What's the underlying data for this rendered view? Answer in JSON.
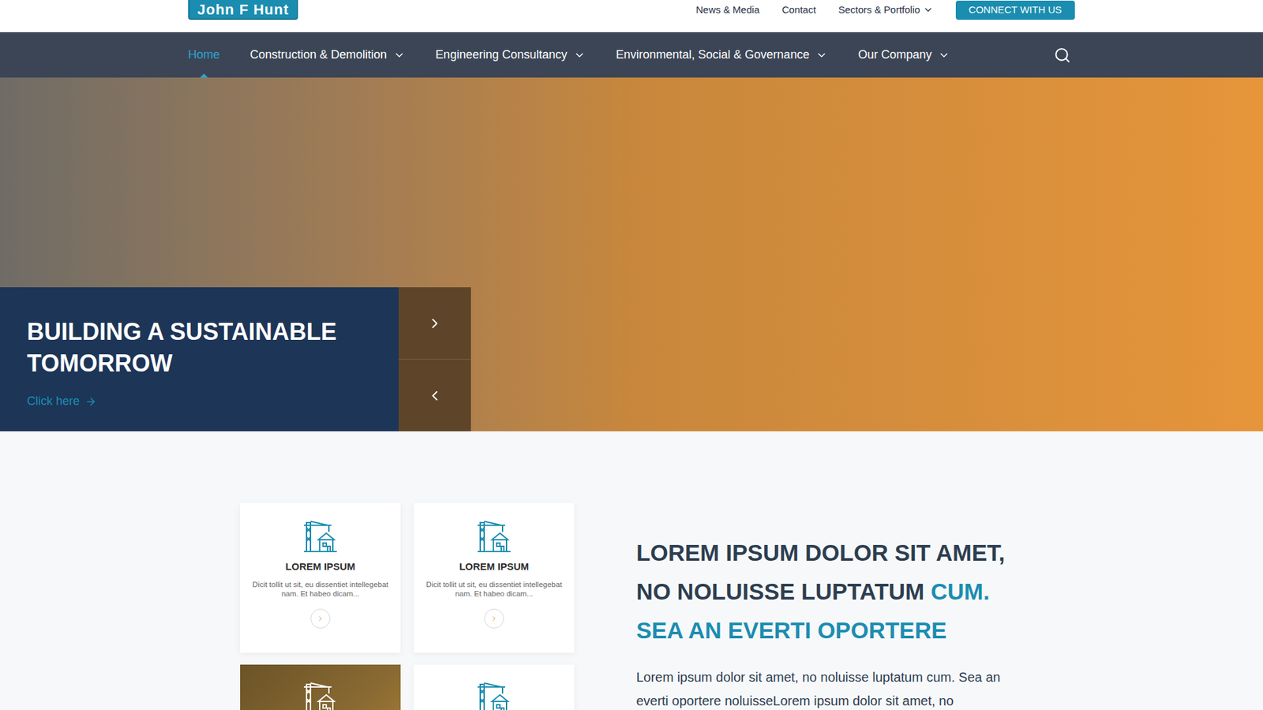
{
  "logo": "John F Hunt",
  "top_links": [
    {
      "label": "News & Media",
      "dropdown": false
    },
    {
      "label": "Contact",
      "dropdown": false
    },
    {
      "label": "Sectors & Portfolio",
      "dropdown": true
    }
  ],
  "connect_button": "CONNECT WITH US",
  "nav": [
    {
      "label": "Home",
      "selected": true,
      "dropdown": false
    },
    {
      "label": "Construction & Demolition",
      "selected": false,
      "dropdown": true
    },
    {
      "label": "Engineering Consultancy",
      "selected": false,
      "dropdown": true
    },
    {
      "label": "Environmental, Social & Governance",
      "selected": false,
      "dropdown": true
    },
    {
      "label": "Our Company",
      "selected": false,
      "dropdown": true
    }
  ],
  "hero": {
    "title": "BUILDING A SUSTAINABLE TOMORROW",
    "link": "Click here"
  },
  "cards": [
    {
      "kind": "text",
      "title": "LOREM IPSUM",
      "text": "Dicit tollit ut sit, eu dissentiet intellegebat nam. Et habeo dicam..."
    },
    {
      "kind": "text",
      "title": "LOREM IPSUM",
      "text": "Dicit tollit ut sit, eu dissentiet intellegebat nam. Et habeo dicam..."
    },
    {
      "kind": "photo"
    },
    {
      "kind": "icon"
    }
  ],
  "intro": {
    "heading": [
      [
        {
          "text": "LOREM IPSUM DOLOR SIT AMET,",
          "color": "#2d3e50"
        }
      ],
      [
        {
          "text": "NO NOLUISSE LUPTATUM ",
          "color": "#2d3e50"
        },
        {
          "text": "CUM.",
          "color": "#1b8db0"
        }
      ],
      [
        {
          "text": "SEA AN EVERTI OPORTERE",
          "color": "#1b8db0"
        }
      ]
    ],
    "body": "Lorem ipsum dolor sit amet, no noluisse luptatum cum. Sea an everti oportere noluisseLorem ipsum dolor sit amet, no"
  }
}
